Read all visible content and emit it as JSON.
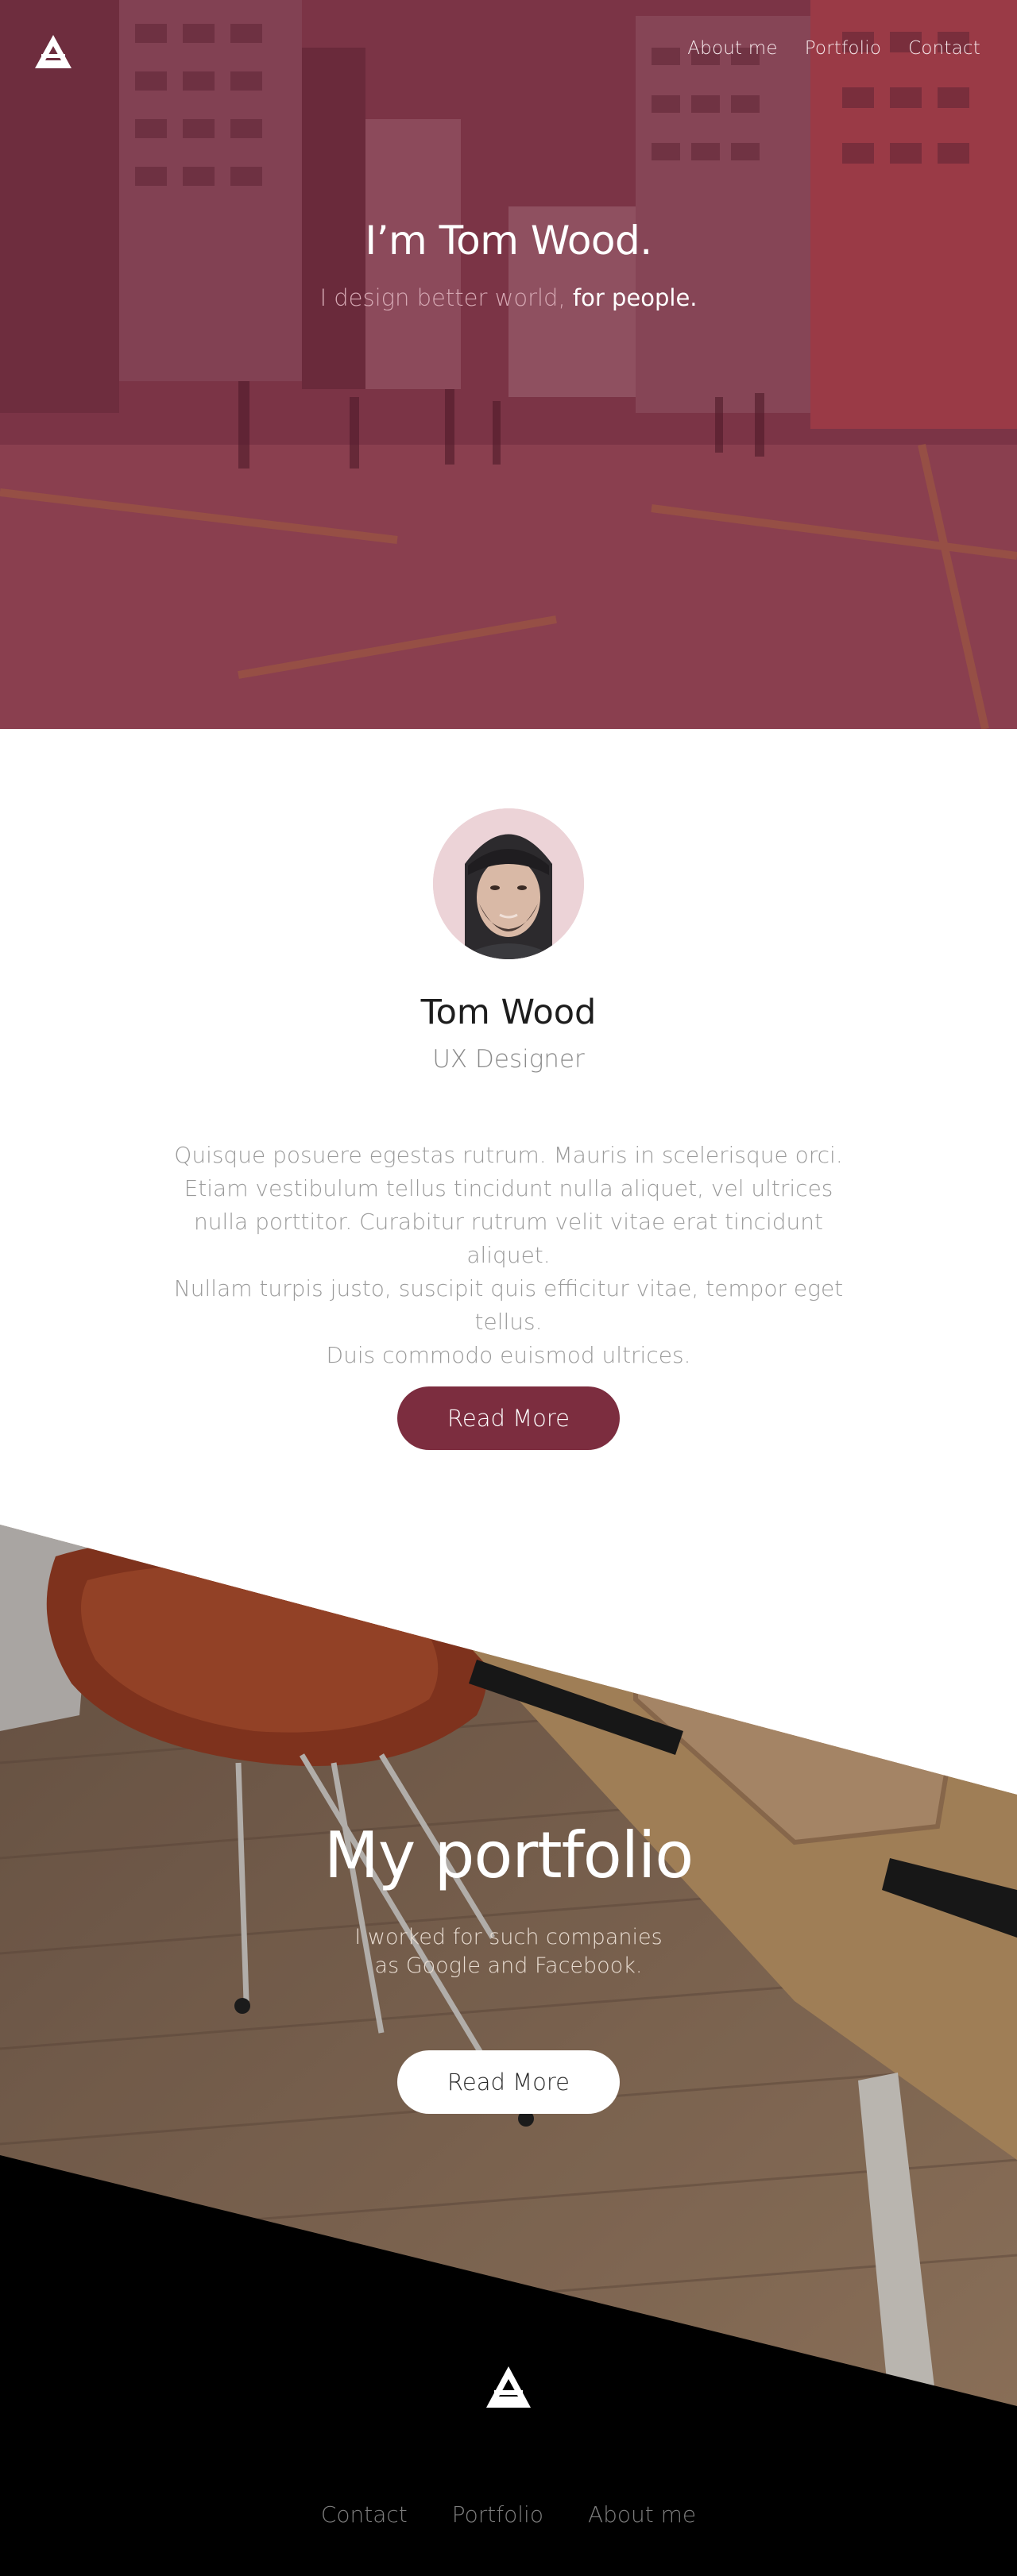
{
  "header": {
    "logo_icon": "triangle-a-logo-icon",
    "nav": [
      {
        "label": "About me"
      },
      {
        "label": "Portfolio"
      },
      {
        "label": "Contact"
      }
    ]
  },
  "hero": {
    "title": "I’m Tom Wood.",
    "subtitle_lead": "I design better world, ",
    "subtitle_bold": "for people.",
    "overlay_color": "#7a3345"
  },
  "about": {
    "avatar_icon": "avatar-photo",
    "name": "Tom Wood",
    "role": "UX Designer",
    "text": [
      "Quisque posuere egestas rutrum. Mauris in scelerisque orci.",
      "Etiam vestibulum tellus tincidunt nulla aliquet, vel ultrices",
      "nulla porttitor. Curabitur rutrum velit vitae erat tincidunt aliquet.",
      "Nullam turpis justo, suscipit quis efficitur vitae, tempor eget tellus.",
      "Duis commodo euismod ultrices."
    ],
    "button_label": "Read More",
    "accent_color": "#7c2d3f"
  },
  "portfolio": {
    "title": "My portfolio",
    "subtitle_line1": "I worked for such companies",
    "subtitle_line2": "as Google and Facebook.",
    "button_label": "Read More"
  },
  "footer": {
    "logo_icon": "triangle-a-logo-icon",
    "nav": [
      {
        "label": "Contact"
      },
      {
        "label": "Portfolio"
      },
      {
        "label": "About me"
      }
    ]
  }
}
